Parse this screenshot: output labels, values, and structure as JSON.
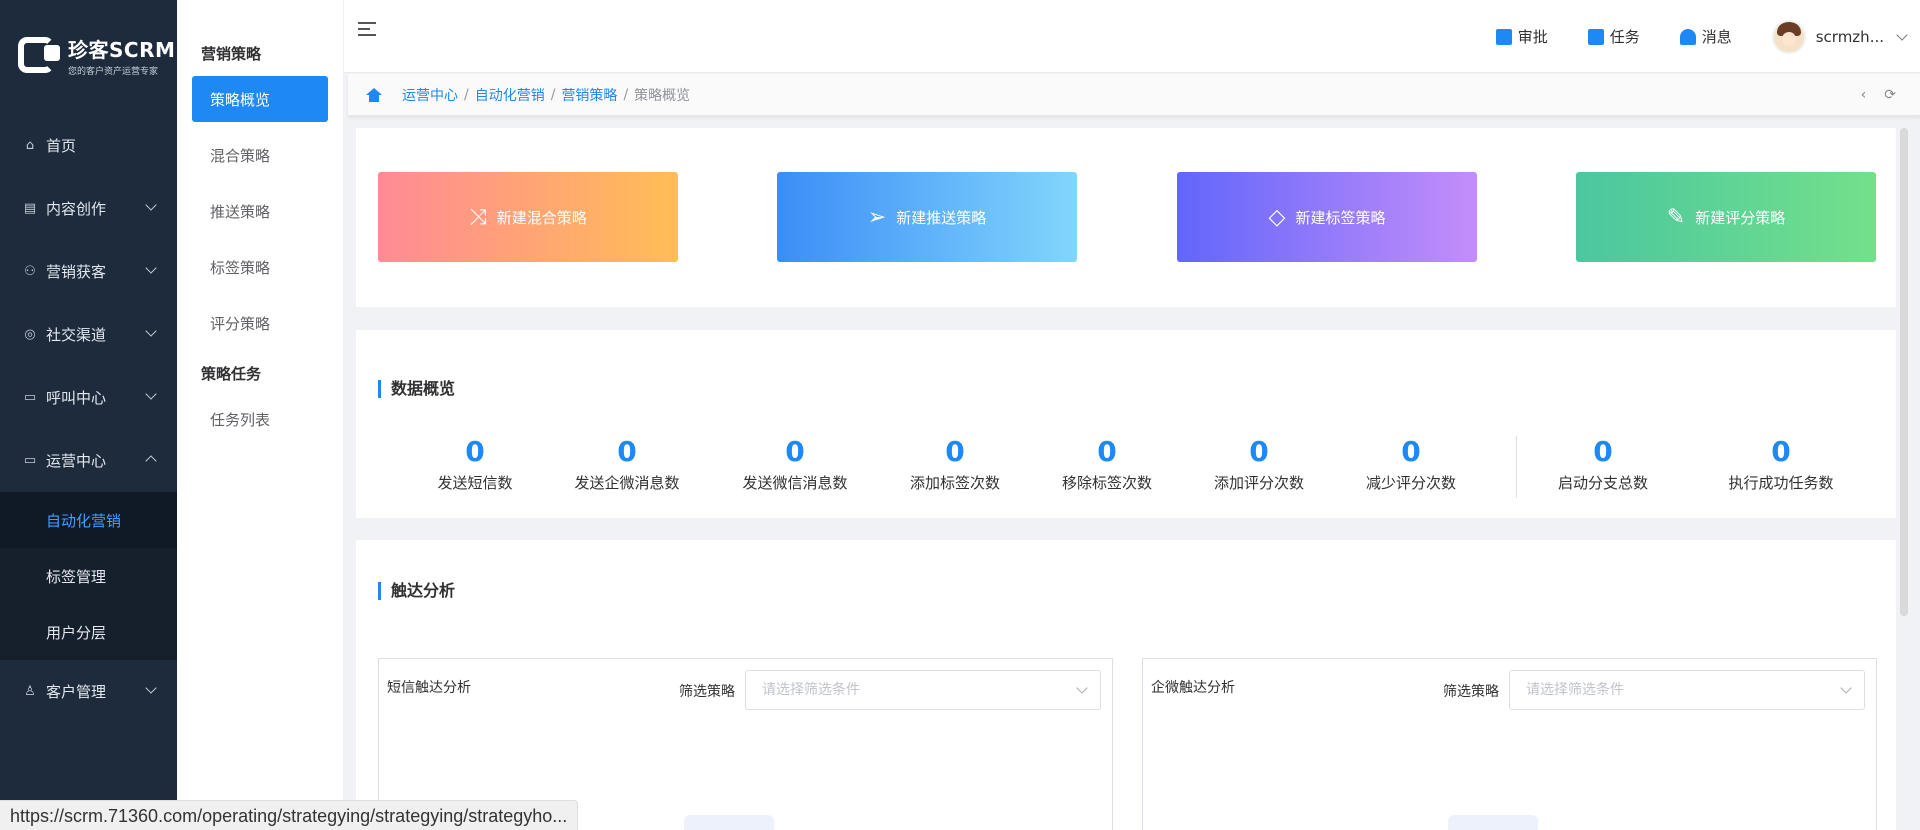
{
  "logo": {
    "title": "珍客SCRM",
    "subtitle": "您的客户资产运营专家"
  },
  "sidebar": {
    "items": [
      {
        "label": "首页",
        "icon": "home-icon"
      },
      {
        "label": "内容创作",
        "icon": "document-icon"
      },
      {
        "label": "营销获客",
        "icon": "users-icon"
      },
      {
        "label": "社交渠道",
        "icon": "target-icon"
      },
      {
        "label": "呼叫中心",
        "icon": "monitor-icon"
      },
      {
        "label": "运营中心",
        "icon": "chart-monitor-icon"
      }
    ],
    "sub_items": [
      {
        "label": "自动化营销",
        "active": true
      },
      {
        "label": "标签管理"
      },
      {
        "label": "用户分层"
      }
    ],
    "last_item": {
      "label": "客户管理",
      "icon": "user-icon"
    }
  },
  "sidebar2": {
    "group1": "营销策略",
    "group1_items": [
      "策略概览",
      "混合策略",
      "推送策略",
      "标签策略",
      "评分策略"
    ],
    "group2": "策略任务",
    "group2_items": [
      "任务列表"
    ]
  },
  "header": {
    "approve": "审批",
    "task": "任务",
    "message": "消息",
    "username": "scrmzh..."
  },
  "breadcrumb": {
    "items": [
      "运营中心",
      "自动化营销",
      "营销策略"
    ],
    "current": "策略概览"
  },
  "actions": [
    {
      "label": "新建混合策略",
      "icon": "shuffle-icon"
    },
    {
      "label": "新建推送策略",
      "icon": "send-icon"
    },
    {
      "label": "新建标签策略",
      "icon": "tag-icon"
    },
    {
      "label": "新建评分策略",
      "icon": "edit-icon"
    }
  ],
  "overview": {
    "title": "数据概览",
    "stats": [
      {
        "value": "0",
        "label": "发送短信数"
      },
      {
        "value": "0",
        "label": "发送企微消息数"
      },
      {
        "value": "0",
        "label": "发送微信消息数"
      },
      {
        "value": "0",
        "label": "添加标签次数"
      },
      {
        "value": "0",
        "label": "移除标签次数"
      },
      {
        "value": "0",
        "label": "添加评分次数"
      },
      {
        "value": "0",
        "label": "减少评分次数"
      },
      {
        "value": "0",
        "label": "启动分支总数"
      },
      {
        "value": "0",
        "label": "执行成功任务数"
      }
    ]
  },
  "reach": {
    "title": "触达分析",
    "boxes": [
      {
        "title": "短信触达分析",
        "filter_label": "筛选策略",
        "placeholder": "请选择筛选条件"
      },
      {
        "title": "企微触达分析",
        "filter_label": "筛选策略",
        "placeholder": "请选择筛选条件"
      }
    ]
  },
  "status_url": "https://scrm.71360.com/operating/strategying/strategying/strategyho..."
}
